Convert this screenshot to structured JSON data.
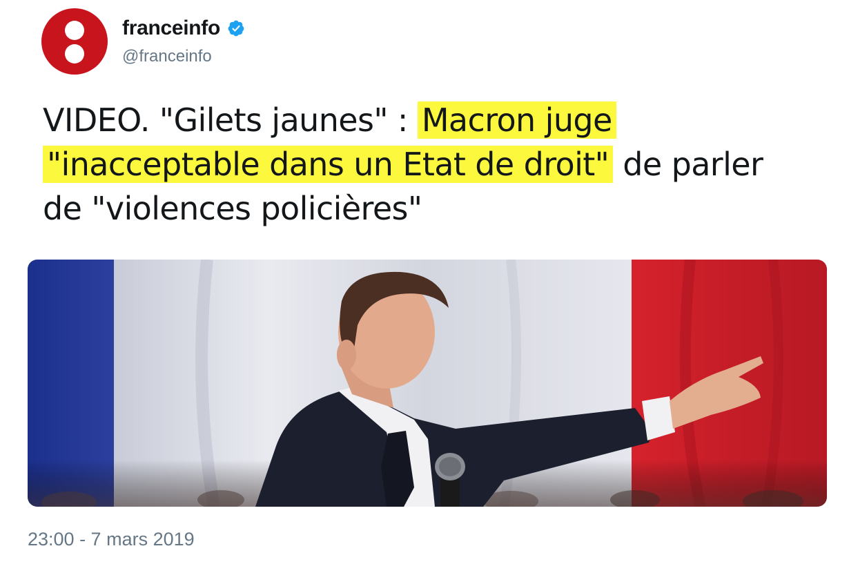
{
  "account": {
    "display_name": "franceinfo",
    "handle": "@franceinfo",
    "verified": true,
    "verified_icon": "verified-badge-icon",
    "avatar_icon": "franceinfo-logo-icon"
  },
  "tweet": {
    "text_prefix": "VIDEO. \"Gilets jaunes\" : ",
    "text_highlight_1": "Macron juge",
    "text_highlight_2": "\"inacceptable dans un Etat de droit\"",
    "text_suffix_1": " de parler",
    "text_suffix_2": "de \"violences policières\""
  },
  "media": {
    "type": "photo",
    "subject": "press-photo-image"
  },
  "timestamp": "23:00 - 7 mars 2019",
  "colors": {
    "brand_red": "#c8141c",
    "verified_blue": "#1da1f2",
    "highlight_yellow": "#fbf83d",
    "muted_text": "#657786"
  }
}
